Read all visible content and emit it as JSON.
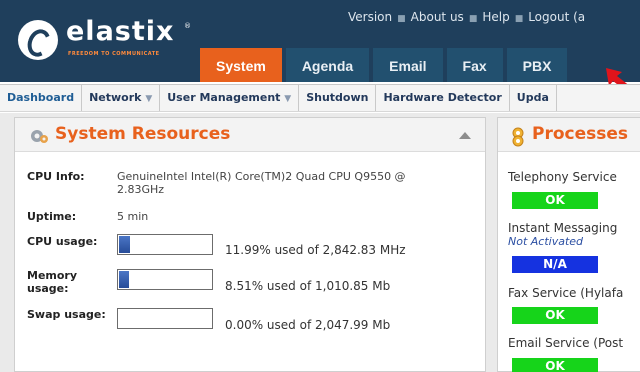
{
  "brand": {
    "name": "elastix",
    "tagline": "FREEDOM TO COMMUNICATE",
    "registered": "®"
  },
  "top_links": [
    "Version",
    "About us",
    "Help",
    "Logout (a"
  ],
  "tabs": [
    {
      "label": "System",
      "active": true
    },
    {
      "label": "Agenda",
      "active": false
    },
    {
      "label": "Email",
      "active": false
    },
    {
      "label": "Fax",
      "active": false
    },
    {
      "label": "PBX",
      "active": false
    }
  ],
  "subnav": [
    {
      "label": "Dashboard",
      "dropdown": false
    },
    {
      "label": "Network",
      "dropdown": true
    },
    {
      "label": "User Management",
      "dropdown": true
    },
    {
      "label": "Shutdown",
      "dropdown": false
    },
    {
      "label": "Hardware Detector",
      "dropdown": false
    },
    {
      "label": "Upda",
      "dropdown": false
    }
  ],
  "dropdown_glyph": "▼",
  "resources": {
    "title": "System Resources",
    "cpu_info_label": "CPU Info:",
    "cpu_info_line1": "GenuineIntel Intel(R) Core(TM)2 Quad CPU Q9550 @",
    "cpu_info_line2": "2.83GHz",
    "uptime_label": "Uptime:",
    "uptime_value": "5 min",
    "cpu_usage_label": "CPU usage:",
    "cpu_usage_text": "11.99% used of 2,842.83 MHz",
    "cpu_usage_fraction": 0.1199,
    "memory_label_line1": "Memory",
    "memory_label_line2": "usage:",
    "memory_usage_text": "8.51% used of 1,010.85 Mb",
    "memory_usage_fraction": 0.0851,
    "swap_label": "Swap usage:",
    "swap_usage_text": "0.00% used of 2,047.99 Mb",
    "swap_usage_fraction": 0.0
  },
  "processes": {
    "title": "Processes",
    "services": [
      {
        "name": "Telephony Service",
        "note": "",
        "status": "OK"
      },
      {
        "name": "Instant Messaging",
        "note": "Not Activated",
        "status": "N/A"
      },
      {
        "name": "Fax Service  (Hylafa",
        "note": "",
        "status": "OK"
      },
      {
        "name": "Email Service  (Post",
        "note": "",
        "status": "OK"
      }
    ]
  },
  "colors": {
    "header_bg": "#1f3f5c",
    "accent_orange": "#e8611d",
    "tab_bg": "#22506f",
    "ok_green": "#16d41a",
    "na_blue": "#1532e0",
    "bar_blue": "#274c98"
  },
  "icons": {
    "resources": "gear-icon",
    "processes": "processes-icon",
    "collapse": "collapse-icon",
    "pointer": "red-arrow-icon"
  }
}
